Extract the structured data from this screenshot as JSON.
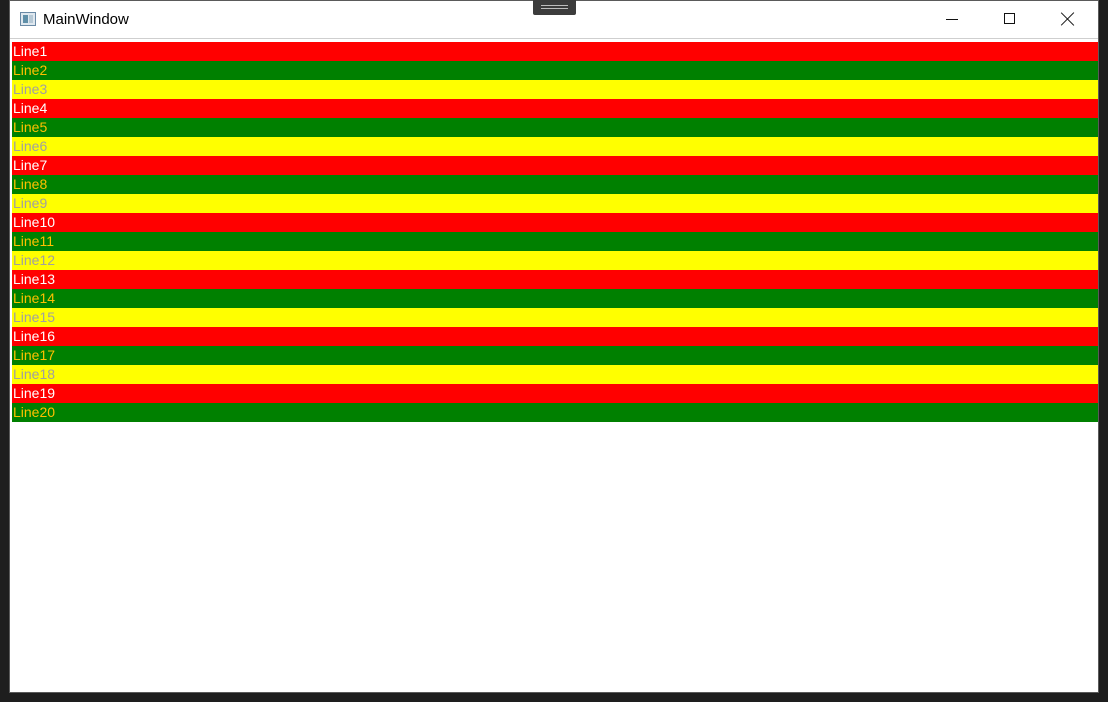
{
  "window": {
    "title": "MainWindow"
  },
  "title_bar_buttons": {
    "minimize_icon": "minimize-icon",
    "maximize_icon": "maximize-icon",
    "close_icon": "close-icon"
  },
  "colors": {
    "red": "#ff0000",
    "green": "#008000",
    "yellow": "#ffff00",
    "text_on_red": "#ffffff",
    "text_on_green": "#ffc000",
    "text_on_yellow": "#a0a0a0"
  },
  "rows": [
    {
      "label": "Line1",
      "bg": "red"
    },
    {
      "label": "Line2",
      "bg": "green"
    },
    {
      "label": "Line3",
      "bg": "yellow"
    },
    {
      "label": "Line4",
      "bg": "red"
    },
    {
      "label": "Line5",
      "bg": "green"
    },
    {
      "label": "Line6",
      "bg": "yellow"
    },
    {
      "label": "Line7",
      "bg": "red"
    },
    {
      "label": "Line8",
      "bg": "green"
    },
    {
      "label": "Line9",
      "bg": "yellow"
    },
    {
      "label": "Line10",
      "bg": "red"
    },
    {
      "label": "Line11",
      "bg": "green"
    },
    {
      "label": "Line12",
      "bg": "yellow"
    },
    {
      "label": "Line13",
      "bg": "red"
    },
    {
      "label": "Line14",
      "bg": "green"
    },
    {
      "label": "Line15",
      "bg": "yellow"
    },
    {
      "label": "Line16",
      "bg": "red"
    },
    {
      "label": "Line17",
      "bg": "green"
    },
    {
      "label": "Line18",
      "bg": "yellow"
    },
    {
      "label": "Line19",
      "bg": "red"
    },
    {
      "label": "Line20",
      "bg": "green"
    }
  ]
}
